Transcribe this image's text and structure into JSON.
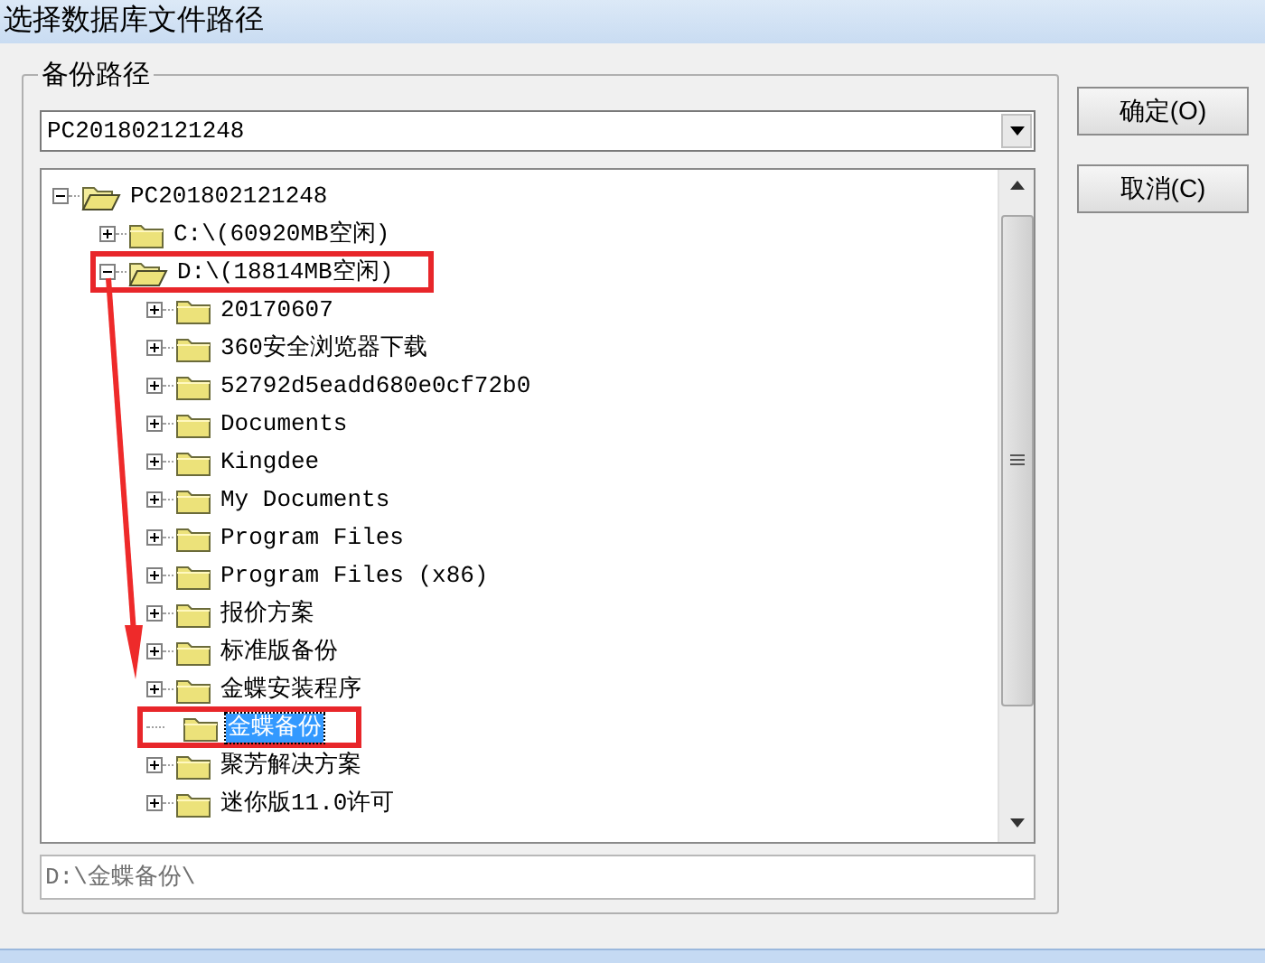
{
  "window": {
    "title": "选择数据库文件路径"
  },
  "group": {
    "label": "备份路径"
  },
  "drive_combo": {
    "value": "PC201802121248"
  },
  "tree": [
    {
      "label": "PC201802121248",
      "kind": "branch",
      "expanded": true,
      "selected": false,
      "highlighted": false,
      "children": [
        {
          "label": "C:\\(60920MB空闲)",
          "kind": "branch",
          "expanded": false,
          "selected": false,
          "highlighted": false
        },
        {
          "label": "D:\\(18814MB空闲)",
          "kind": "branch",
          "expanded": true,
          "selected": false,
          "highlighted": true,
          "children": [
            {
              "label": "20170607",
              "kind": "branch",
              "expanded": false,
              "selected": false,
              "highlighted": false
            },
            {
              "label": "360安全浏览器下载",
              "kind": "branch",
              "expanded": false,
              "selected": false,
              "highlighted": false
            },
            {
              "label": "52792d5eadd680e0cf72b0",
              "kind": "branch",
              "expanded": false,
              "selected": false,
              "highlighted": false
            },
            {
              "label": "Documents",
              "kind": "branch",
              "expanded": false,
              "selected": false,
              "highlighted": false
            },
            {
              "label": "Kingdee",
              "kind": "branch",
              "expanded": false,
              "selected": false,
              "highlighted": false
            },
            {
              "label": "My Documents",
              "kind": "branch",
              "expanded": false,
              "selected": false,
              "highlighted": false
            },
            {
              "label": "Program Files",
              "kind": "branch",
              "expanded": false,
              "selected": false,
              "highlighted": false
            },
            {
              "label": "Program Files (x86)",
              "kind": "branch",
              "expanded": false,
              "selected": false,
              "highlighted": false
            },
            {
              "label": "报价方案",
              "kind": "branch",
              "expanded": false,
              "selected": false,
              "highlighted": false
            },
            {
              "label": "标准版备份",
              "kind": "branch",
              "expanded": false,
              "selected": false,
              "highlighted": false
            },
            {
              "label": "金蝶安装程序",
              "kind": "branch",
              "expanded": false,
              "selected": false,
              "highlighted": false
            },
            {
              "label": "金蝶备份",
              "kind": "leaf",
              "expanded": false,
              "selected": true,
              "highlighted": true
            },
            {
              "label": "聚芳解决方案",
              "kind": "branch",
              "expanded": false,
              "selected": false,
              "highlighted": false
            },
            {
              "label": "迷你版11.0许可",
              "kind": "branch",
              "expanded": false,
              "selected": false,
              "highlighted": false
            }
          ]
        }
      ]
    }
  ],
  "path_field": {
    "value": "D:\\金蝶备份\\"
  },
  "buttons": [
    {
      "label": "确定(O)"
    },
    {
      "label": "取消(C)"
    }
  ]
}
